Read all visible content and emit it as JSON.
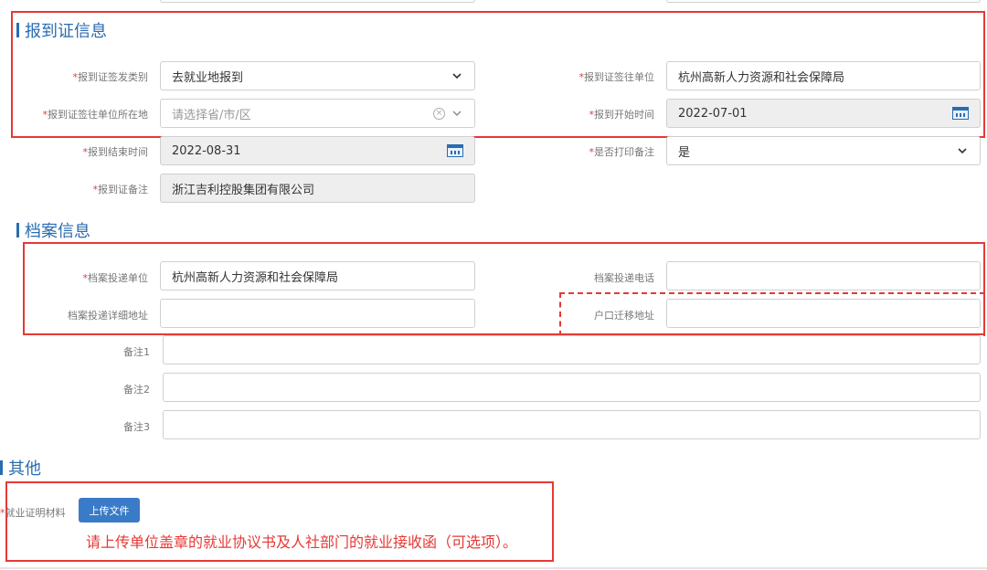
{
  "sections": {
    "report": {
      "title": "报到证信息"
    },
    "archive": {
      "title": "档案信息"
    },
    "other": {
      "title": "其他"
    }
  },
  "report": {
    "issue_type": {
      "label": "报到证签发类别",
      "value": "去就业地报到"
    },
    "dest_unit": {
      "label": "报到证签往单位",
      "value": "杭州高新人力资源和社会保障局"
    },
    "dest_location": {
      "label": "报到证签往单位所在地",
      "placeholder": "请选择省/市/区"
    },
    "start_date": {
      "label": "报到开始时间",
      "value": "2022-07-01"
    },
    "end_date": {
      "label": "报到结束时间",
      "value": "2022-08-31"
    },
    "print_remark": {
      "label": "是否打印备注",
      "value": "是"
    },
    "remark": {
      "label": "报到证备注",
      "value": "浙江吉利控股集团有限公司"
    }
  },
  "archive": {
    "delivery_unit": {
      "label": "档案投递单位",
      "value": "杭州高新人力资源和社会保障局"
    },
    "delivery_phone": {
      "label": "档案投递电话",
      "value": ""
    },
    "delivery_address": {
      "label": "档案投递详细地址",
      "value": ""
    },
    "hukou_address": {
      "label": "户口迁移地址",
      "value": ""
    },
    "note1": {
      "label": "备注1",
      "value": ""
    },
    "note2": {
      "label": "备注2",
      "value": ""
    },
    "note3": {
      "label": "备注3",
      "value": ""
    }
  },
  "other": {
    "proof_label": "就业证明材料",
    "upload_label": "上传文件",
    "hint": "请上传单位盖章的就业协议书及人社部门的就业接收函（可选项）。"
  },
  "colors": {
    "accent": "#2b6cb0",
    "highlight": "#e53935",
    "button": "#3a7bc8"
  }
}
